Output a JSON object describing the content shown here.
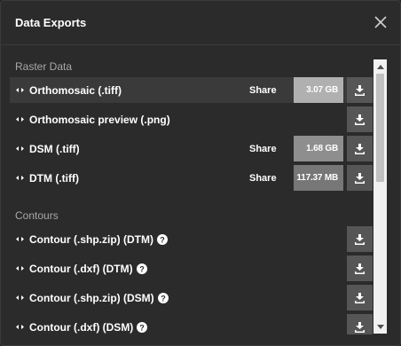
{
  "dialog": {
    "title": "Data Exports",
    "close_icon": "close-icon"
  },
  "sections": {
    "raster": {
      "heading": "Raster Data",
      "rows": [
        {
          "label": "Orthomosaic (.tiff)",
          "share": "Share",
          "size": "3.07 GB"
        },
        {
          "label": "Orthomosaic preview (.png)"
        },
        {
          "label": "DSM (.tiff)",
          "share": "Share",
          "size": "1.68 GB"
        },
        {
          "label": "DTM (.tiff)",
          "share": "Share",
          "size": "117.37 MB"
        }
      ]
    },
    "contours": {
      "heading": "Contours",
      "rows": [
        {
          "label": "Contour (.shp.zip) (DTM)",
          "help_icon": "help-icon"
        },
        {
          "label": "Contour (.dxf) (DTM)",
          "help_icon": "help-icon"
        },
        {
          "label": "Contour (.shp.zip) (DSM)",
          "help_icon": "help-icon"
        },
        {
          "label": "Contour (.dxf) (DSM)",
          "help_icon": "help-icon"
        }
      ]
    }
  },
  "icons": {
    "row_handle": "expand-arrows-icon",
    "download": "download-icon"
  },
  "colors": {
    "background": "#2b2b2b",
    "highlight_row": "#3a3a3a",
    "size_badge_large": "#b0b0b0",
    "size_badge_medium": "#8e8e8e",
    "size_badge_small": "#777777",
    "download_button": "#565656"
  }
}
